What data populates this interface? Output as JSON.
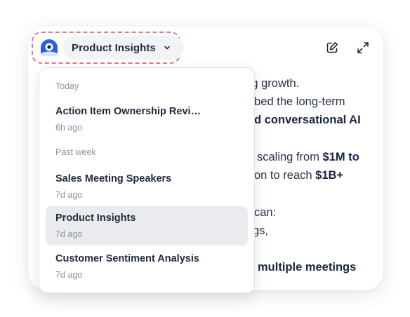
{
  "header": {
    "selector_label": "Product Insights",
    "icons": [
      "logo-icon",
      "chevron-down-icon",
      "compose-icon",
      "expand-icon"
    ]
  },
  "body_lines": [
    {
      "pre": "ong growth.",
      "bold": ""
    },
    {
      "pre": "ribed the long-term",
      "bold": ""
    },
    {
      "pre": "",
      "bold": "nd conversational AI"
    },
    {
      "pre": "scaling from ",
      "bold": "$1M to"
    },
    {
      "pre": "on to reach ",
      "bold": "$1B+"
    },
    {
      "pre": "can:",
      "bold": ""
    },
    {
      "pre": "gs,",
      "bold": ""
    },
    {
      "pre": "",
      "bold": "multiple meetings"
    }
  ],
  "dropdown": {
    "sections": [
      {
        "label": "Today",
        "items": [
          {
            "title": "Action Item Ownership Revi…",
            "time": "6h ago"
          }
        ]
      },
      {
        "label": "Past week",
        "items": [
          {
            "title": "Sales Meeting Speakers",
            "time": "7d ago"
          },
          {
            "title": "Product Insights",
            "time": "7d ago"
          },
          {
            "title": "Customer Sentiment Analysis",
            "time": "7d ago"
          }
        ]
      }
    ]
  },
  "colors": {
    "accent": "#2f5fe0",
    "highlight_dash": "#e8787f",
    "selected_bg": "#e9ebef",
    "muted_text": "#8a93a3"
  }
}
